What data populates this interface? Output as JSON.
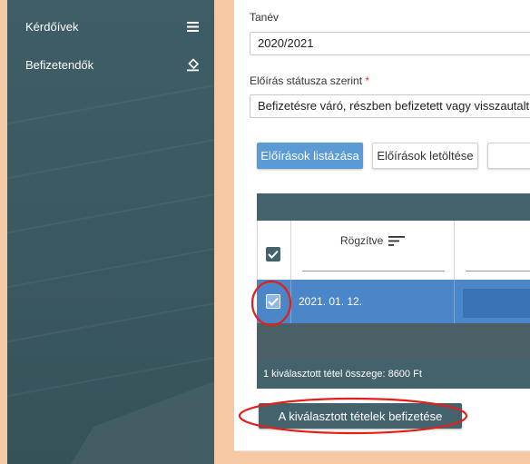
{
  "sidebar": {
    "items": [
      {
        "label": "Kérdőívek",
        "icon": "list-icon"
      },
      {
        "label": "Befizetendők",
        "icon": "eraser-icon"
      }
    ]
  },
  "form": {
    "year": {
      "label": "Tanév",
      "value": "2020/2021"
    },
    "status": {
      "label": "Előírás státusza szerint",
      "required_mark": "*",
      "value": "Befizetésre váró, részben befizetett vagy visszautalt"
    }
  },
  "buttons": {
    "list_label": "Előírások listázása",
    "download_label": "Előírások letöltése",
    "pay_selected_label": "A kiválasztott tételek befizetése"
  },
  "grid": {
    "column_title": "Rögzítve",
    "rows": [
      {
        "date": "2021. 01. 12.",
        "selected": true
      }
    ],
    "summary": "1 kiválasztott tétel összege: 8600 Ft"
  },
  "colors": {
    "sidebar": "#3e5d66",
    "header_band": "#44626b",
    "primary_button": "#5b9bd5",
    "selected_row": "#4a86c8",
    "annotation_red": "#e0201b",
    "background": "#f6c9a4"
  }
}
